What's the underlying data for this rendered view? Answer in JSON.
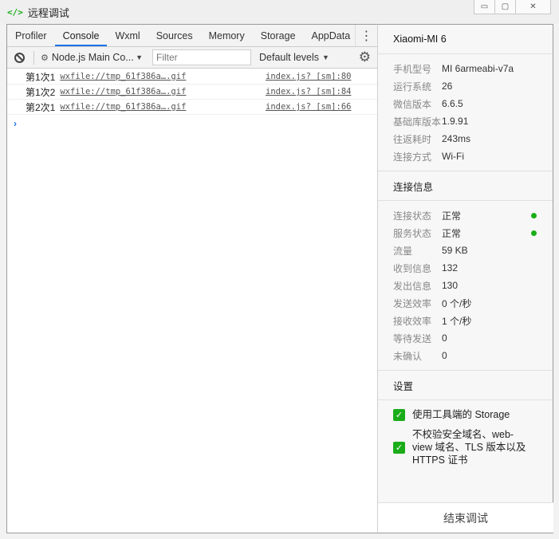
{
  "window": {
    "icon": "code-icon",
    "title": "远程调试",
    "controls": [
      "minimize",
      "maximize",
      "close"
    ]
  },
  "devtools": {
    "tabs": [
      {
        "label": "Profiler",
        "active": false
      },
      {
        "label": "Console",
        "active": true
      },
      {
        "label": "Wxml",
        "active": false
      },
      {
        "label": "Sources",
        "active": false
      },
      {
        "label": "Memory",
        "active": false
      },
      {
        "label": "Storage",
        "active": false
      },
      {
        "label": "AppData",
        "active": false
      }
    ],
    "toolbar": {
      "context": "Node.js Main Co...",
      "filter_placeholder": "Filter",
      "levels": "Default levels"
    },
    "logs": [
      {
        "message": "第1次1",
        "link": "wxfile://tmp_61f386a….gif",
        "source": "index.js? [sm]:80"
      },
      {
        "message": "第1次2",
        "link": "wxfile://tmp_61f386a….gif",
        "source": "index.js? [sm]:84"
      },
      {
        "message": "第2次1",
        "link": "wxfile://tmp_61f386a….gif",
        "source": "index.js? [sm]:66"
      }
    ],
    "prompt": "›"
  },
  "info": {
    "device": "Xiaomi-MI 6",
    "device_info": [
      {
        "key": "手机型号",
        "value": "MI 6armeabi-v7a"
      },
      {
        "key": "运行系统",
        "value": "26"
      },
      {
        "key": "微信版本",
        "value": "6.6.5"
      },
      {
        "key": "基础库版本",
        "value": "1.9.91"
      },
      {
        "key": "往返耗时",
        "value": "243ms"
      },
      {
        "key": "连接方式",
        "value": "Wi-Fi"
      }
    ],
    "connection_title": "连接信息",
    "connection": [
      {
        "key": "连接状态",
        "value": "正常",
        "dot": true
      },
      {
        "key": "服务状态",
        "value": "正常",
        "dot": true
      },
      {
        "key": "流量",
        "value": "59 KB"
      },
      {
        "key": "收到信息",
        "value": "132"
      },
      {
        "key": "发出信息",
        "value": "130"
      },
      {
        "key": "发送效率",
        "value": "0 个/秒"
      },
      {
        "key": "接收效率",
        "value": "1 个/秒"
      },
      {
        "key": "等待发送",
        "value": "0"
      },
      {
        "key": "未确认",
        "value": "0"
      }
    ],
    "settings_title": "设置",
    "settings": [
      {
        "label": "使用工具端的 Storage",
        "checked": true
      },
      {
        "label": "不校验安全域名、web-view 域名、TLS 版本以及 HTTPS 证书",
        "checked": true
      }
    ],
    "end_button": "结束调试"
  },
  "colors": {
    "accent": "#1aad19",
    "tab_active": "#1a73e8"
  }
}
